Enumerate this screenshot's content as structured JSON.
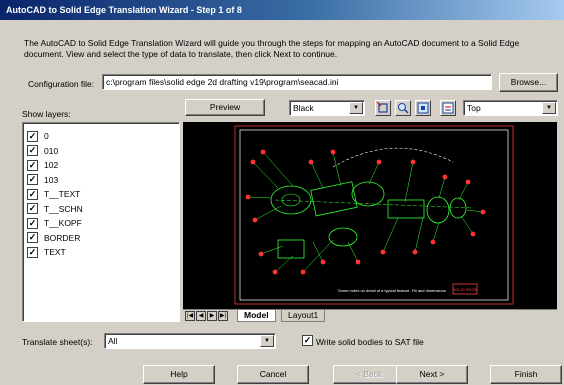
{
  "window": {
    "title": "AutoCAD to Solid Edge Translation Wizard - Step 1 of 8"
  },
  "intro": "The AutoCAD to Solid Edge Translation  Wizard will guide you through the steps for mapping an AutoCAD document to a Solid Edge document.  View and select the type of data to translate, then click Next to continue.",
  "config": {
    "label": "Configuration file:",
    "value": "c:\\program files\\solid edge 2d drafting v19\\program\\seacad.ini",
    "browse_label": "Browse..."
  },
  "layers": {
    "label": "Show layers:",
    "items": [
      "0",
      "010",
      "102",
      "103",
      "T__TEXT",
      "T__SCHN",
      "T__KOPF",
      "BORDER",
      "TEXT"
    ]
  },
  "preview": {
    "tab_label": "Preview",
    "color_value": "Black",
    "view_value": "Top",
    "caption": "Some notes on detail of a typical feature. Fill and dimensions",
    "stamp": "SOLID EDGE"
  },
  "layout_tabs": [
    "Model",
    "Layout1"
  ],
  "translate": {
    "label": "Translate sheet(s):",
    "value": "All",
    "write_sat_label": "Write solid bodies to SAT file"
  },
  "buttons": {
    "help": "Help",
    "cancel": "Cancel",
    "back": "< Back",
    "next": "Next >",
    "finish": "Finish"
  },
  "colors": {
    "title_start": "#0a246a",
    "title_end": "#a6caf0",
    "drawing_green": "#33ff33",
    "drawing_red": "#ff3333",
    "face": "#d4d0c8"
  }
}
